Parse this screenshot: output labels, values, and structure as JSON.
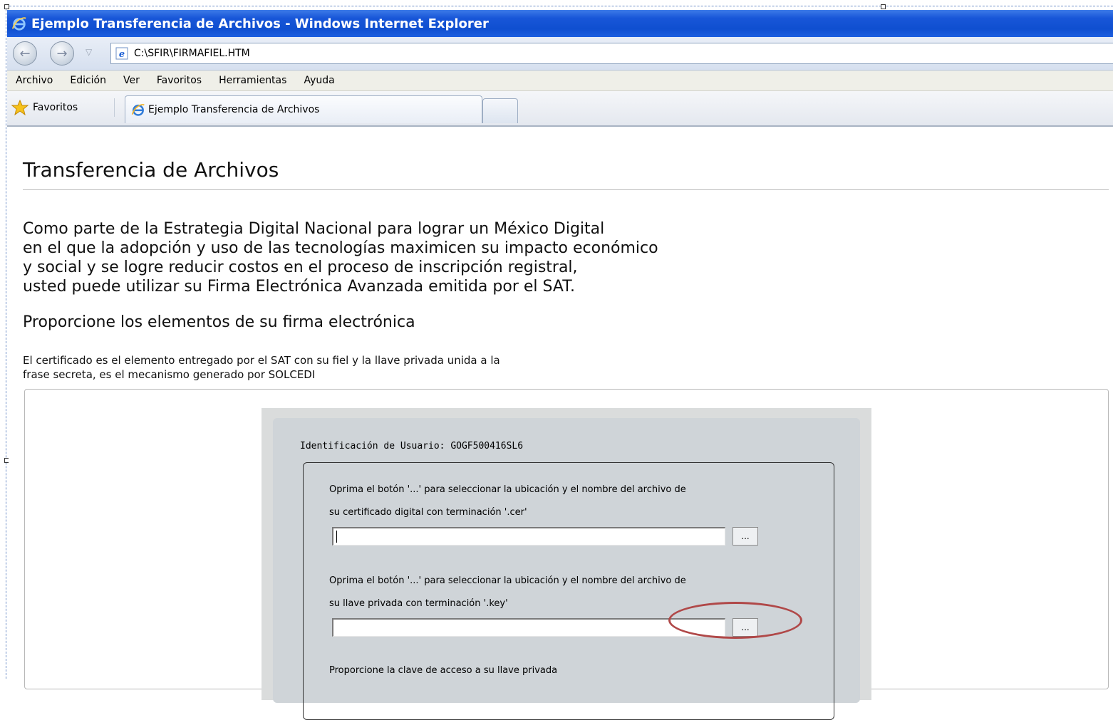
{
  "window": {
    "title": "Ejemplo Transferencia de Archivos - Windows Internet Explorer"
  },
  "address_bar": {
    "url": "C:\\SFIR\\FIRMAFIEL.HTM"
  },
  "menu": {
    "items": [
      "Archivo",
      "Edición",
      "Ver",
      "Favoritos",
      "Herramientas",
      "Ayuda"
    ]
  },
  "favorites_bar": {
    "favorites_label": "Favoritos",
    "tab_title": "Ejemplo Transferencia de Archivos"
  },
  "page": {
    "heading": "Transferencia de Archivos",
    "intro_lines": [
      "Como parte de la Estrategia Digital Nacional para lograr un México Digital",
      "en el que la adopción y uso de las tecnologías maximicen su impacto económico",
      "y social y se logre reducir costos en el proceso de inscripción registral,",
      "usted puede utilizar su Firma Electrónica Avanzada emitida por el SAT."
    ],
    "subheading": "Proporcione los elementos de su firma electrónica",
    "note_lines": [
      "El certificado es el elemento entregado por el SAT con su fiel y la llave privada unida a la",
      "frase secreta, es el mecanismo generado por SOLCEDI"
    ]
  },
  "form": {
    "user_id_label": "Identificación de Usuario: GOGF500416SL6",
    "cert_label_1": "Oprima el  botón '...' para seleccionar la ubicación y el nombre del archivo de",
    "cert_label_2": "su certificado digital con terminación '.cer'",
    "cert_value": "",
    "key_label_1": "Oprima el  botón '...' para seleccionar la ubicación y el nombre del archivo de",
    "key_label_2": "su llave privada con terminación '.key'",
    "key_value": "",
    "browse_label": "...",
    "password_label": "Proporcione la clave de acceso a su llave privada"
  },
  "colors": {
    "titlebar": "#1856d8",
    "highlight_ellipse": "#b04848"
  }
}
